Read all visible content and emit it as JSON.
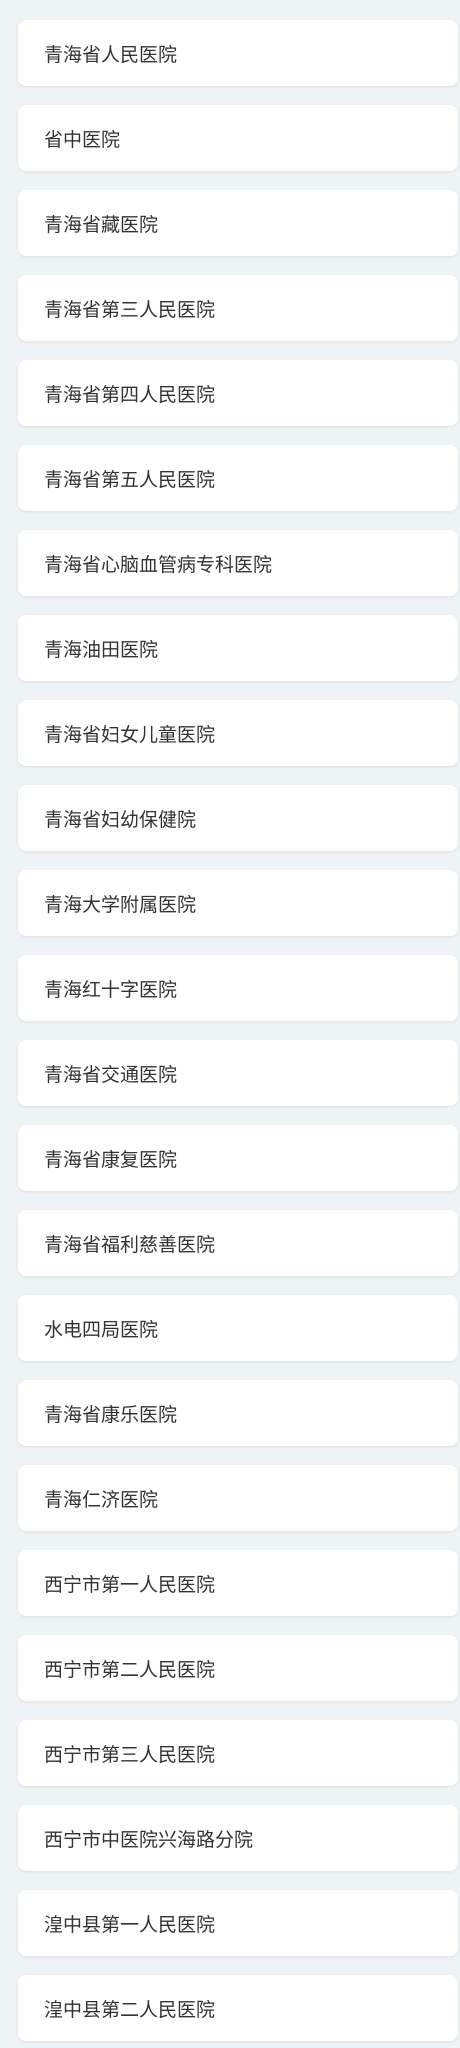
{
  "hospitals": [
    {
      "name": "青海省人民医院"
    },
    {
      "name": "省中医院"
    },
    {
      "name": "青海省藏医院"
    },
    {
      "name": "青海省第三人民医院"
    },
    {
      "name": "青海省第四人民医院"
    },
    {
      "name": "青海省第五人民医院"
    },
    {
      "name": "青海省心脑血管病专科医院"
    },
    {
      "name": "青海油田医院"
    },
    {
      "name": "青海省妇女儿童医院"
    },
    {
      "name": "青海省妇幼保健院"
    },
    {
      "name": "青海大学附属医院"
    },
    {
      "name": "青海红十字医院"
    },
    {
      "name": "青海省交通医院"
    },
    {
      "name": "青海省康复医院"
    },
    {
      "name": "青海省福利慈善医院"
    },
    {
      "name": "水电四局医院"
    },
    {
      "name": "青海省康乐医院"
    },
    {
      "name": "青海仁济医院"
    },
    {
      "name": "西宁市第一人民医院"
    },
    {
      "name": "西宁市第二人民医院"
    },
    {
      "name": "西宁市第三人民医院"
    },
    {
      "name": "西宁市中医院兴海路分院"
    },
    {
      "name": "湟中县第一人民医院"
    },
    {
      "name": "湟中县第二人民医院"
    }
  ]
}
